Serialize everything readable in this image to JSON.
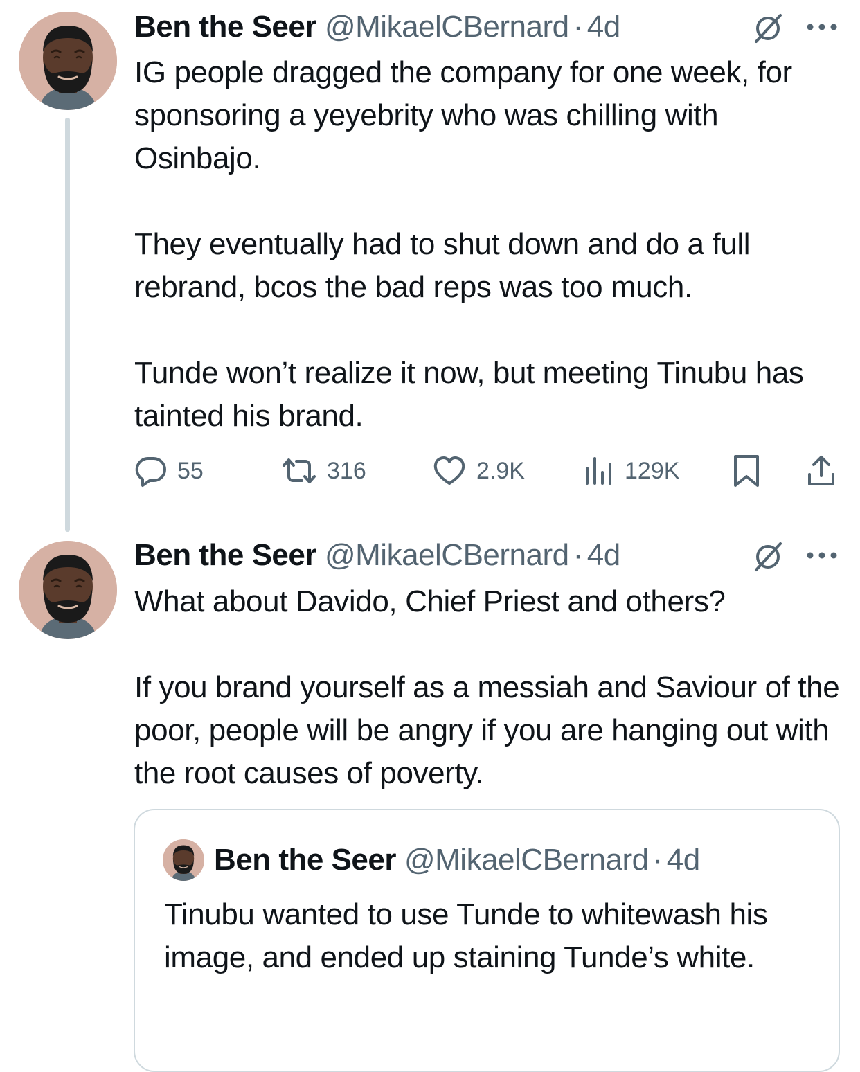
{
  "thread": [
    {
      "author": {
        "display_name": "Ben the Seer",
        "handle": "@MikaelCBernard",
        "separator": "·",
        "time": "4d"
      },
      "paragraphs": [
        "IG people dragged the company for one week, for sponsoring a yeyebrity who was chilling with Osinbajo.",
        "They eventually had to shut down and do a full rebrand, bcos the bad reps was too much.",
        "Tunde won’t realize it now, but meeting Tinubu has tainted his brand."
      ],
      "stats": {
        "replies": "55",
        "reposts": "316",
        "likes": "2.9K",
        "views": "129K"
      },
      "icons": {
        "reply": "reply-icon",
        "repost": "repost-icon",
        "like": "heart-icon",
        "views": "views-chart-icon",
        "bookmark": "bookmark-icon",
        "share": "share-icon",
        "grok": "grok-icon",
        "more": "more-icon"
      }
    },
    {
      "author": {
        "display_name": "Ben the Seer",
        "handle": "@MikaelCBernard",
        "separator": "·",
        "time": "4d"
      },
      "paragraphs": [
        "What about Davido, Chief Priest and others?",
        "If you brand yourself as a messiah and Saviour of the poor, people will be angry if you are hanging out with the root causes of poverty."
      ],
      "quote": {
        "author": {
          "display_name": "Ben the Seer",
          "handle": "@MikaelCBernard",
          "separator": "·",
          "time": "4d"
        },
        "text": "Tinubu wanted to use Tunde to whitewash his image, and ended up staining Tunde’s white."
      }
    }
  ],
  "colors": {
    "text_primary": "#0f1419",
    "text_secondary": "#536471",
    "border": "#cfd9de",
    "avatar_bg": "#d6b1a4",
    "skin": "#5a3b2c",
    "beard": "#1a1a1a"
  }
}
